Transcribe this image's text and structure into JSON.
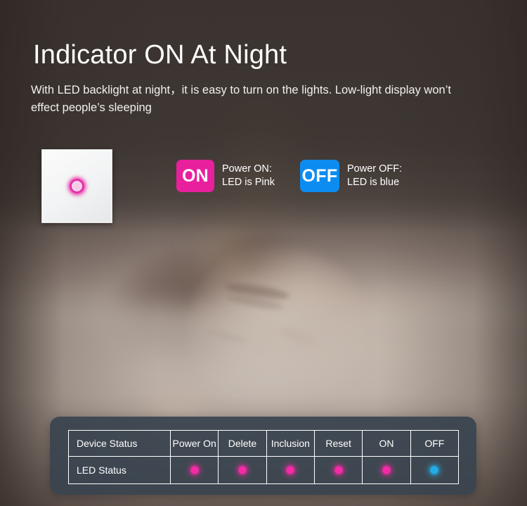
{
  "header": {
    "title": "Indicator ON At Night",
    "subtitle": "With LED backlight at night，it is easy to turn on the lights. Low-light display won’t effect people’s sleeping"
  },
  "switch": {
    "name": "wall-touch-switch",
    "led_color": "#e530a8",
    "led_state": "pink-glow"
  },
  "legend": {
    "on": {
      "badge": "ON",
      "badge_color": "#e8209e",
      "line1": "Power ON:",
      "line2": "LED is Pink"
    },
    "off": {
      "badge": "OFF",
      "badge_color": "#0c8cf0",
      "line1": "Power OFF:",
      "line2": "LED is blue"
    }
  },
  "status_table": {
    "headers": [
      "Device Status",
      "Power On",
      "Delete",
      "Inclusion",
      "Reset",
      "ON",
      "OFF"
    ],
    "row_label": "LED Status",
    "led_states": [
      "pink",
      "pink",
      "pink",
      "pink",
      "pink",
      "blue"
    ],
    "colors": {
      "pink": "#f42aa6",
      "blue": "#22ade8",
      "panel": "#39444f",
      "border": "#ffffff"
    }
  }
}
